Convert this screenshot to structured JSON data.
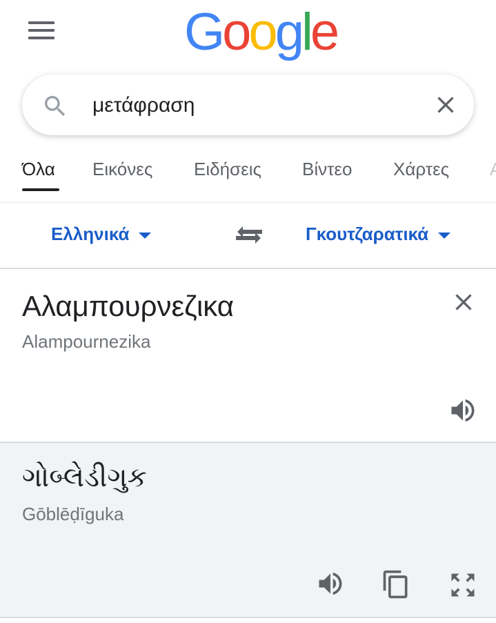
{
  "header": {
    "menu_icon": "hamburger-menu-icon",
    "logo_letters": [
      {
        "char": "G",
        "color": "#4285F4"
      },
      {
        "char": "o",
        "color": "#EA4335"
      },
      {
        "char": "o",
        "color": "#FBBC05"
      },
      {
        "char": "g",
        "color": "#4285F4"
      },
      {
        "char": "l",
        "color": "#34A853"
      },
      {
        "char": "e",
        "color": "#EA4335"
      }
    ]
  },
  "search": {
    "value": "μετάφραση",
    "search_icon": "search-icon",
    "clear_icon": "close-icon"
  },
  "tabs": {
    "items": [
      {
        "label": "Όλα",
        "active": true
      },
      {
        "label": "Εικόνες",
        "active": false
      },
      {
        "label": "Ειδήσεις",
        "active": false
      },
      {
        "label": "Βίντεο",
        "active": false
      },
      {
        "label": "Χάρτες",
        "active": false
      }
    ],
    "overflow_hint": "Α"
  },
  "translator": {
    "source_language": "Ελληνικά",
    "target_language": "Γκουτζαρατικά",
    "swap_icon": "swap-arrows-icon",
    "accent_color": "#1A5DC9",
    "source": {
      "text": "Αλαμπουρνεζικα",
      "transliteration": "Alampournezika",
      "clear_icon": "close-icon",
      "listen_icon": "speaker-icon"
    },
    "target": {
      "text": "ગોબ્લેડીગુક",
      "transliteration": "Gōblēḍīguka",
      "listen_icon": "speaker-icon",
      "copy_icon": "copy-icon",
      "expand_icon": "fullscreen-icon"
    }
  }
}
